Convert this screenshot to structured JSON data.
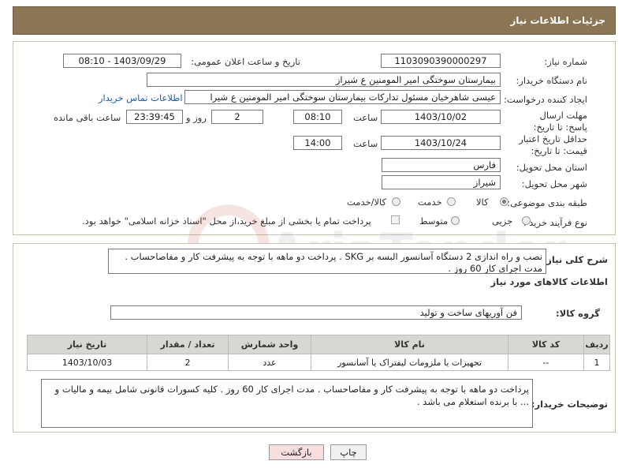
{
  "header": {
    "title": "جزئیات اطلاعات نیاز"
  },
  "fields": {
    "need_number_label": "شماره نیاز:",
    "need_number": "1103090390000297",
    "announce_label": "تاریخ و ساعت اعلان عمومی:",
    "announce_value": "1403/09/29 - 08:10",
    "buyer_label": "نام دستگاه خریدار:",
    "buyer_value": "بیمارستان سوختگی امیر المومنین  ع  شیراز",
    "creator_label": "ایجاد کننده درخواست:",
    "creator_value": "عیسی  شاهرخیان مسئول تدارکات بیمارستان سوختگی امیر المومنین  ع  شیرا",
    "contact_link": "اطلاعات تماس خریدار",
    "reply_deadline_label": "مهلت ارسال پاسخ: تا تاریخ:",
    "reply_date": "1403/10/02",
    "time_label": "ساعت",
    "reply_time": "08:10",
    "days_value": "2",
    "days_label": "روز و",
    "remaining_value": "23:39:45",
    "remaining_label": "ساعت باقی مانده",
    "price_validity_label": "حداقل تاریخ اعتبار قیمت: تا تاریخ:",
    "price_date": "1403/10/24",
    "price_time": "14:00",
    "province_label": "استان محل تحویل:",
    "province_value": "فارس",
    "city_label": "شهر محل تحویل:",
    "city_value": "شیراز",
    "category_label": "طبقه بندی موضوعی:",
    "category_options": [
      "کالا",
      "خدمت",
      "کالا/خدمت"
    ],
    "category_selected": "کالا",
    "process_label": "نوع فرآیند خرید :",
    "process_options": [
      "جزیی",
      "متوسط"
    ],
    "payment_note": "پرداخت تمام یا بخشی از مبلغ خرید،از محل \"اسناد خزانه اسلامی\" خواهد بود."
  },
  "description": {
    "label": "شرح کلی نیاز:",
    "text": "نصب و راه اندازی 2 دستگاه آسانسور البسه بر SKG . پرداخت دو ماهه با توجه به پیشرفت کار و مفاصاحساب . مدت اجرای کار 60 روز ."
  },
  "goods_info": {
    "title": "اطلاعات کالاهای مورد نیاز",
    "group_label": "گروه کالا:",
    "group_value": "فن آوریهای ساخت و تولید"
  },
  "table": {
    "headers": [
      "ردیف",
      "کد کالا",
      "نام کالا",
      "واحد شمارش",
      "تعداد / مقدار",
      "تاریخ نیاز"
    ],
    "rows": [
      [
        "1",
        "--",
        "تجهیزات یا ملزومات لیفتراک یا آسانسور",
        "عدد",
        "2",
        "1403/10/03"
      ]
    ]
  },
  "buyer_notes": {
    "label": "توضیحات خریدار:",
    "text": "پرداخت دو ماهه با توجه به پیشرفت کار و مفاصاحساب . مدت اجرای کار 60 روز . کلیه کسورات قانونی شامل بیمه و مالیات و ... با برنده استعلام می باشد ."
  },
  "buttons": {
    "print": "چاپ",
    "back": "بازگشت"
  },
  "watermark": {
    "text": "AriaTender.neT"
  }
}
